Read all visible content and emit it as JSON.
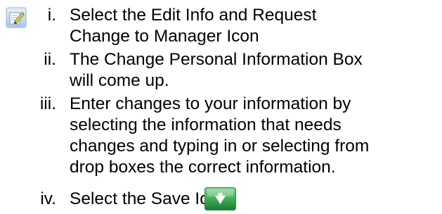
{
  "icons": {
    "edit_info": "edit-info-icon",
    "save": "save-icon"
  },
  "steps": [
    {
      "number": "i.",
      "lines": [
        "Select the Edit Info and Request",
        "Change to Manager Icon"
      ]
    },
    {
      "number": "ii.",
      "lines": [
        "The Change Personal Information Box",
        "will come up."
      ]
    },
    {
      "number": "iii.",
      "lines": [
        "Enter changes to your information by",
        "selecting the information that needs",
        "changes and typing in or selecting from",
        "drop boxes the correct information."
      ]
    },
    {
      "number": "iv.",
      "lines": [
        "Select the Save Icon"
      ]
    }
  ],
  "colors": {
    "save_icon_green": "#3fae55",
    "edit_icon_blue": "#b9d4ef",
    "text": "#000000"
  }
}
